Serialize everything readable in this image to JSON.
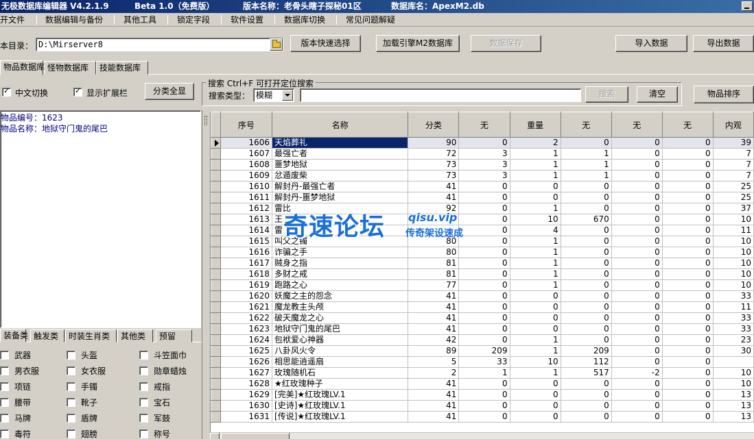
{
  "window": {
    "app_title": "无极数据库编辑器 V4.2.1.9",
    "beta": "Beta 1.0（免费版）",
    "version_name": "版本名称：老骨头瞎子探秘01区",
    "db_name": "数据库名：ApexM2.db"
  },
  "menu": [
    "开文件",
    "数据编辑与备份",
    "其他工具",
    "锁定字段",
    "软件设置",
    "数据库切换",
    "常见问题解疑"
  ],
  "toolbar": {
    "dir_label": "本目录：",
    "dir_value": "D:\\Mirserver8",
    "quick_select": "版本快速选择",
    "load_engine": "加载引擎M2数据库",
    "save_data": "数据保存",
    "import_data": "导入数据",
    "export_data": "导出数据"
  },
  "tabs": [
    "物品数据库",
    "怪物数据库",
    "技能数据库"
  ],
  "options": {
    "chinese_switch": "中文切换",
    "show_extend": "显示扩展栏",
    "category_all": "分类全显"
  },
  "search": {
    "group_title": "搜索    Ctrl+F 可打开定位搜索",
    "type_label": "搜索类型：",
    "type_value": "模糊",
    "search_btn": "搜索",
    "clear_btn": "清空",
    "sort_btn": "物品排序"
  },
  "info": {
    "item_no": "物品编号：1623",
    "item_name": "物品名称：地狱守门鬼的尾巴"
  },
  "grid": {
    "columns": [
      "序号",
      "名称",
      "分类",
      "无",
      "重量",
      "无",
      "无",
      "无",
      "内观"
    ],
    "rows": [
      [
        "1606",
        "天焰葬礼",
        "90",
        "0",
        "2",
        "0",
        "0",
        "0",
        "39"
      ],
      [
        "1607",
        "最强亡者",
        "72",
        "3",
        "1",
        "1",
        "0",
        "0",
        "7"
      ],
      [
        "1608",
        "噩梦地狱",
        "73",
        "3",
        "1",
        "1",
        "0",
        "0",
        "7"
      ],
      [
        "1609",
        "忿遁废柴",
        "73",
        "3",
        "1",
        "1",
        "0",
        "0",
        "7"
      ],
      [
        "1610",
        "解封丹-最强亡者",
        "41",
        "0",
        "0",
        "0",
        "0",
        "0",
        "25"
      ],
      [
        "1611",
        "解封丹-噩梦地狱",
        "41",
        "0",
        "0",
        "0",
        "0",
        "0",
        "25"
      ],
      [
        "1612",
        "雷比",
        "92",
        "0",
        "1",
        "0",
        "0",
        "0",
        "37"
      ],
      [
        "1613",
        "王",
        "",
        "0",
        "10",
        "670",
        "0",
        "0",
        "10"
      ],
      [
        "1614",
        "雷",
        "",
        "0",
        "4",
        "0",
        "0",
        "0",
        "11"
      ],
      [
        "1615",
        "叫父之镯",
        "80",
        "0",
        "1",
        "0",
        "0",
        "0",
        "10"
      ],
      [
        "1616",
        "诈骗之手",
        "80",
        "0",
        "1",
        "0",
        "0",
        "0",
        "10"
      ],
      [
        "1617",
        "贼身之指",
        "81",
        "0",
        "1",
        "0",
        "0",
        "0",
        "10"
      ],
      [
        "1618",
        "多财之戒",
        "81",
        "0",
        "1",
        "0",
        "0",
        "0",
        "10"
      ],
      [
        "1619",
        "跑路之心",
        "77",
        "0",
        "1",
        "0",
        "0",
        "0",
        "10"
      ],
      [
        "1620",
        "妖魔之主的怨念",
        "41",
        "0",
        "0",
        "0",
        "0",
        "0",
        "33"
      ],
      [
        "1621",
        "魔龙教主头颅",
        "41",
        "0",
        "0",
        "0",
        "0",
        "0",
        "11"
      ],
      [
        "1622",
        "破天魔龙之心",
        "41",
        "0",
        "0",
        "0",
        "0",
        "0",
        "33"
      ],
      [
        "1623",
        "地狱守门鬼的尾巴",
        "41",
        "0",
        "0",
        "0",
        "0",
        "0",
        "33"
      ],
      [
        "1624",
        "包袱爱心神器",
        "42",
        "0",
        "1",
        "0",
        "0",
        "0",
        "23"
      ],
      [
        "1625",
        "八卦风火令",
        "89",
        "209",
        "1",
        "209",
        "0",
        "0",
        "30"
      ],
      [
        "1626",
        "相思能逍遥扇",
        "5",
        "33",
        "10",
        "112",
        "0",
        "0",
        ""
      ],
      [
        "1627",
        "玫瑰随机石",
        "2",
        "1",
        "1",
        "517",
        "-2",
        "0",
        "10"
      ],
      [
        "1628",
        "★红玫瑰种子",
        "41",
        "0",
        "0",
        "0",
        "0",
        "0",
        "10"
      ],
      [
        "1629",
        "[完美]★红玫瑰LV.1",
        "41",
        "0",
        "0",
        "0",
        "0",
        "0",
        "13"
      ],
      [
        "1630",
        "[史诗]★红玫瑰LV.1",
        "41",
        "0",
        "0",
        "0",
        "0",
        "0",
        "13"
      ],
      [
        "1631",
        "[传说]★红玫瑰LV.1",
        "41",
        "0",
        "0",
        "0",
        "0",
        "0",
        "13"
      ]
    ]
  },
  "cat_tabs": [
    "装备类",
    "触发类",
    "时装生肖类",
    "其他类",
    "预留"
  ],
  "categories": [
    [
      "武器",
      "头盔",
      "斗笠面巾"
    ],
    [
      "男衣服",
      "女衣服",
      "勋章蜡烛"
    ],
    [
      "项链",
      "手镯",
      "戒指"
    ],
    [
      "腰带",
      "靴子",
      "宝石"
    ],
    [
      "马牌",
      "盾牌",
      "军鼓"
    ],
    [
      "毒符",
      "翅膀",
      "称号"
    ]
  ],
  "watermark": {
    "big": "奇速论坛",
    "url": "qisu.vip",
    "sub": "传奇架设速成"
  }
}
